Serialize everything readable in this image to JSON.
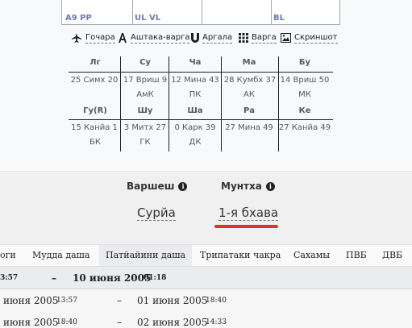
{
  "chart_grid": {
    "labels": [
      "A9 PP",
      "UL VL",
      "",
      "BL"
    ]
  },
  "toolbar": [
    {
      "icon": "airplane-icon",
      "label": "Гочара"
    },
    {
      "icon": "font-icon",
      "label": "Аштака-варга"
    },
    {
      "icon": "magnet-icon",
      "label": "Аргала"
    },
    {
      "icon": "grid-icon",
      "label": "Варга"
    },
    {
      "icon": "image-icon",
      "label": "Скриншот"
    }
  ],
  "planets": {
    "row1": {
      "heads": [
        "Лг",
        "Су",
        "Ча",
        "Ма",
        "Бу"
      ],
      "positions": [
        "25 Симх 20",
        "17 Вриш 9",
        "12 Мина 43",
        "28 Кумбх 37",
        "14 Вриш 50"
      ],
      "subs": [
        "",
        "АмК",
        "ПК",
        "АК",
        "МК"
      ]
    },
    "row2": {
      "heads": [
        "Гу(R)",
        "Шу",
        "Ша",
        "Ра",
        "Ке"
      ],
      "positions": [
        "15 Канйа 1",
        "3 Митх 27",
        "0 Карк 39",
        "27 Мина 49",
        "27 Канйа 49"
      ],
      "subs": [
        "БК",
        "ГК",
        "ДК",
        "",
        ""
      ]
    }
  },
  "selectors": {
    "varshesh": {
      "label": "Варшеш",
      "value": "Сурйа"
    },
    "muntha": {
      "label": "Мунтха",
      "value": "1-я бхава"
    }
  },
  "tabs": [
    "оги",
    "Мудда даша",
    "Патйайини даша",
    "Трипатаки чакра",
    "Сахамы",
    "ПВБ",
    "ДВБ"
  ],
  "active_tab": "Патйайини даша",
  "dasha_rows": [
    {
      "start_date": "",
      "start_time": "3:57",
      "dash": "–",
      "end_date": "10 июня 2005",
      "end_time": "01:18"
    },
    {
      "start_date": "июня 2005",
      "start_time": "13:57",
      "dash": "–",
      "end_date": "01 июня 2005",
      "end_time": "18:40"
    },
    {
      "start_date": "июня 2005",
      "start_time": "18:40",
      "dash": "–",
      "end_date": "02 июня 2005",
      "end_time": "14:33"
    }
  ],
  "colors": {
    "accent_red": "#dd3333",
    "link_blue": "#6b7ab0"
  }
}
